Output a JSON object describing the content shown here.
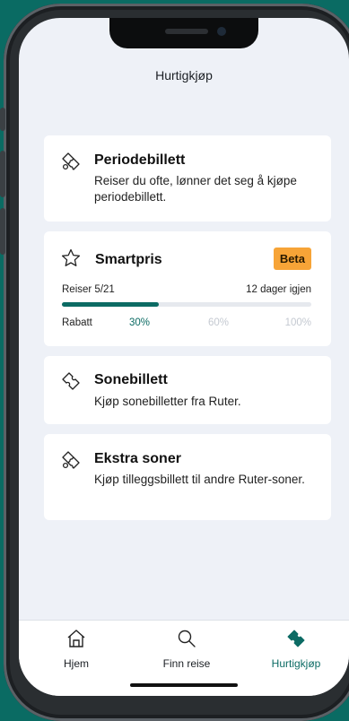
{
  "header": {
    "title": "Hurtigkjøp"
  },
  "cards": {
    "periode": {
      "title": "Periodebillett",
      "description": "Reiser du ofte, lønner det seg å kjøpe periodebillett.",
      "icon": "double-ticket-icon"
    },
    "smartpris": {
      "title": "Smartpris",
      "badge": "Beta",
      "trips_label": "Reiser 5/21",
      "days_left": "12 dager igjen",
      "progress_fraction": 0.39,
      "discount_label": "Rabatt",
      "discount_steps": [
        "30%",
        "60%",
        "100%"
      ],
      "icon": "star-icon"
    },
    "sone": {
      "title": "Sonebillett",
      "description": "Kjøp sonebilletter fra Ruter.",
      "icon": "ticket-icon"
    },
    "ekstra": {
      "title": "Ekstra soner",
      "description": "Kjøp tilleggsbillett til andre Ruter-soner.",
      "icon": "double-ticket-icon"
    }
  },
  "tabbar": {
    "items": [
      {
        "label": "Hjem",
        "icon": "home-icon"
      },
      {
        "label": "Finn reise",
        "icon": "search-icon"
      },
      {
        "label": "Hurtigkjøp",
        "icon": "ticket-filled-icon"
      }
    ],
    "active": "Hurtigkjøp"
  },
  "colors": {
    "accent": "#0c6b64",
    "badge": "#f7a437",
    "background": "#eef1f7",
    "frame_bg": "#0a6b63"
  }
}
